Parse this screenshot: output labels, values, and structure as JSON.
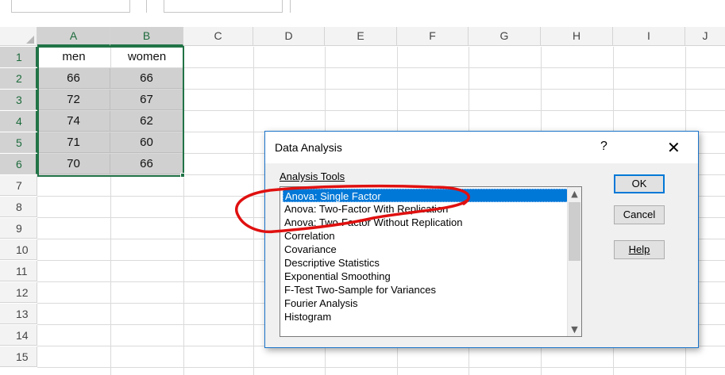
{
  "spreadsheet": {
    "columns": [
      "A",
      "B",
      "C",
      "D",
      "E",
      "F",
      "G",
      "H",
      "I",
      "J"
    ],
    "rows": [
      "1",
      "2",
      "3",
      "4",
      "5",
      "6",
      "7",
      "8",
      "9",
      "10",
      "11",
      "12",
      "13",
      "14",
      "15"
    ],
    "data": [
      [
        "men",
        "women"
      ],
      [
        "66",
        "66"
      ],
      [
        "72",
        "67"
      ],
      [
        "74",
        "62"
      ],
      [
        "71",
        "60"
      ],
      [
        "70",
        "66"
      ]
    ],
    "selection": "A1:B6"
  },
  "dialog": {
    "title": "Data Analysis",
    "help_glyph": "?",
    "close_glyph": "✕",
    "tools_label": "Analysis Tools",
    "tools": [
      "Anova: Single Factor",
      "Anova: Two-Factor With Replication",
      "Anova: Two-Factor Without Replication",
      "Correlation",
      "Covariance",
      "Descriptive Statistics",
      "Exponential Smoothing",
      "F-Test Two-Sample for Variances",
      "Fourier Analysis",
      "Histogram"
    ],
    "selected_tool": "Anova: Single Factor",
    "buttons": {
      "ok": "OK",
      "cancel": "Cancel",
      "help": "Help"
    },
    "scroll_up_glyph": "▲",
    "scroll_down_glyph": "▼"
  },
  "colors": {
    "selection_border": "#217346",
    "annotation": "#e01010",
    "selected_item": "#0078d7"
  }
}
